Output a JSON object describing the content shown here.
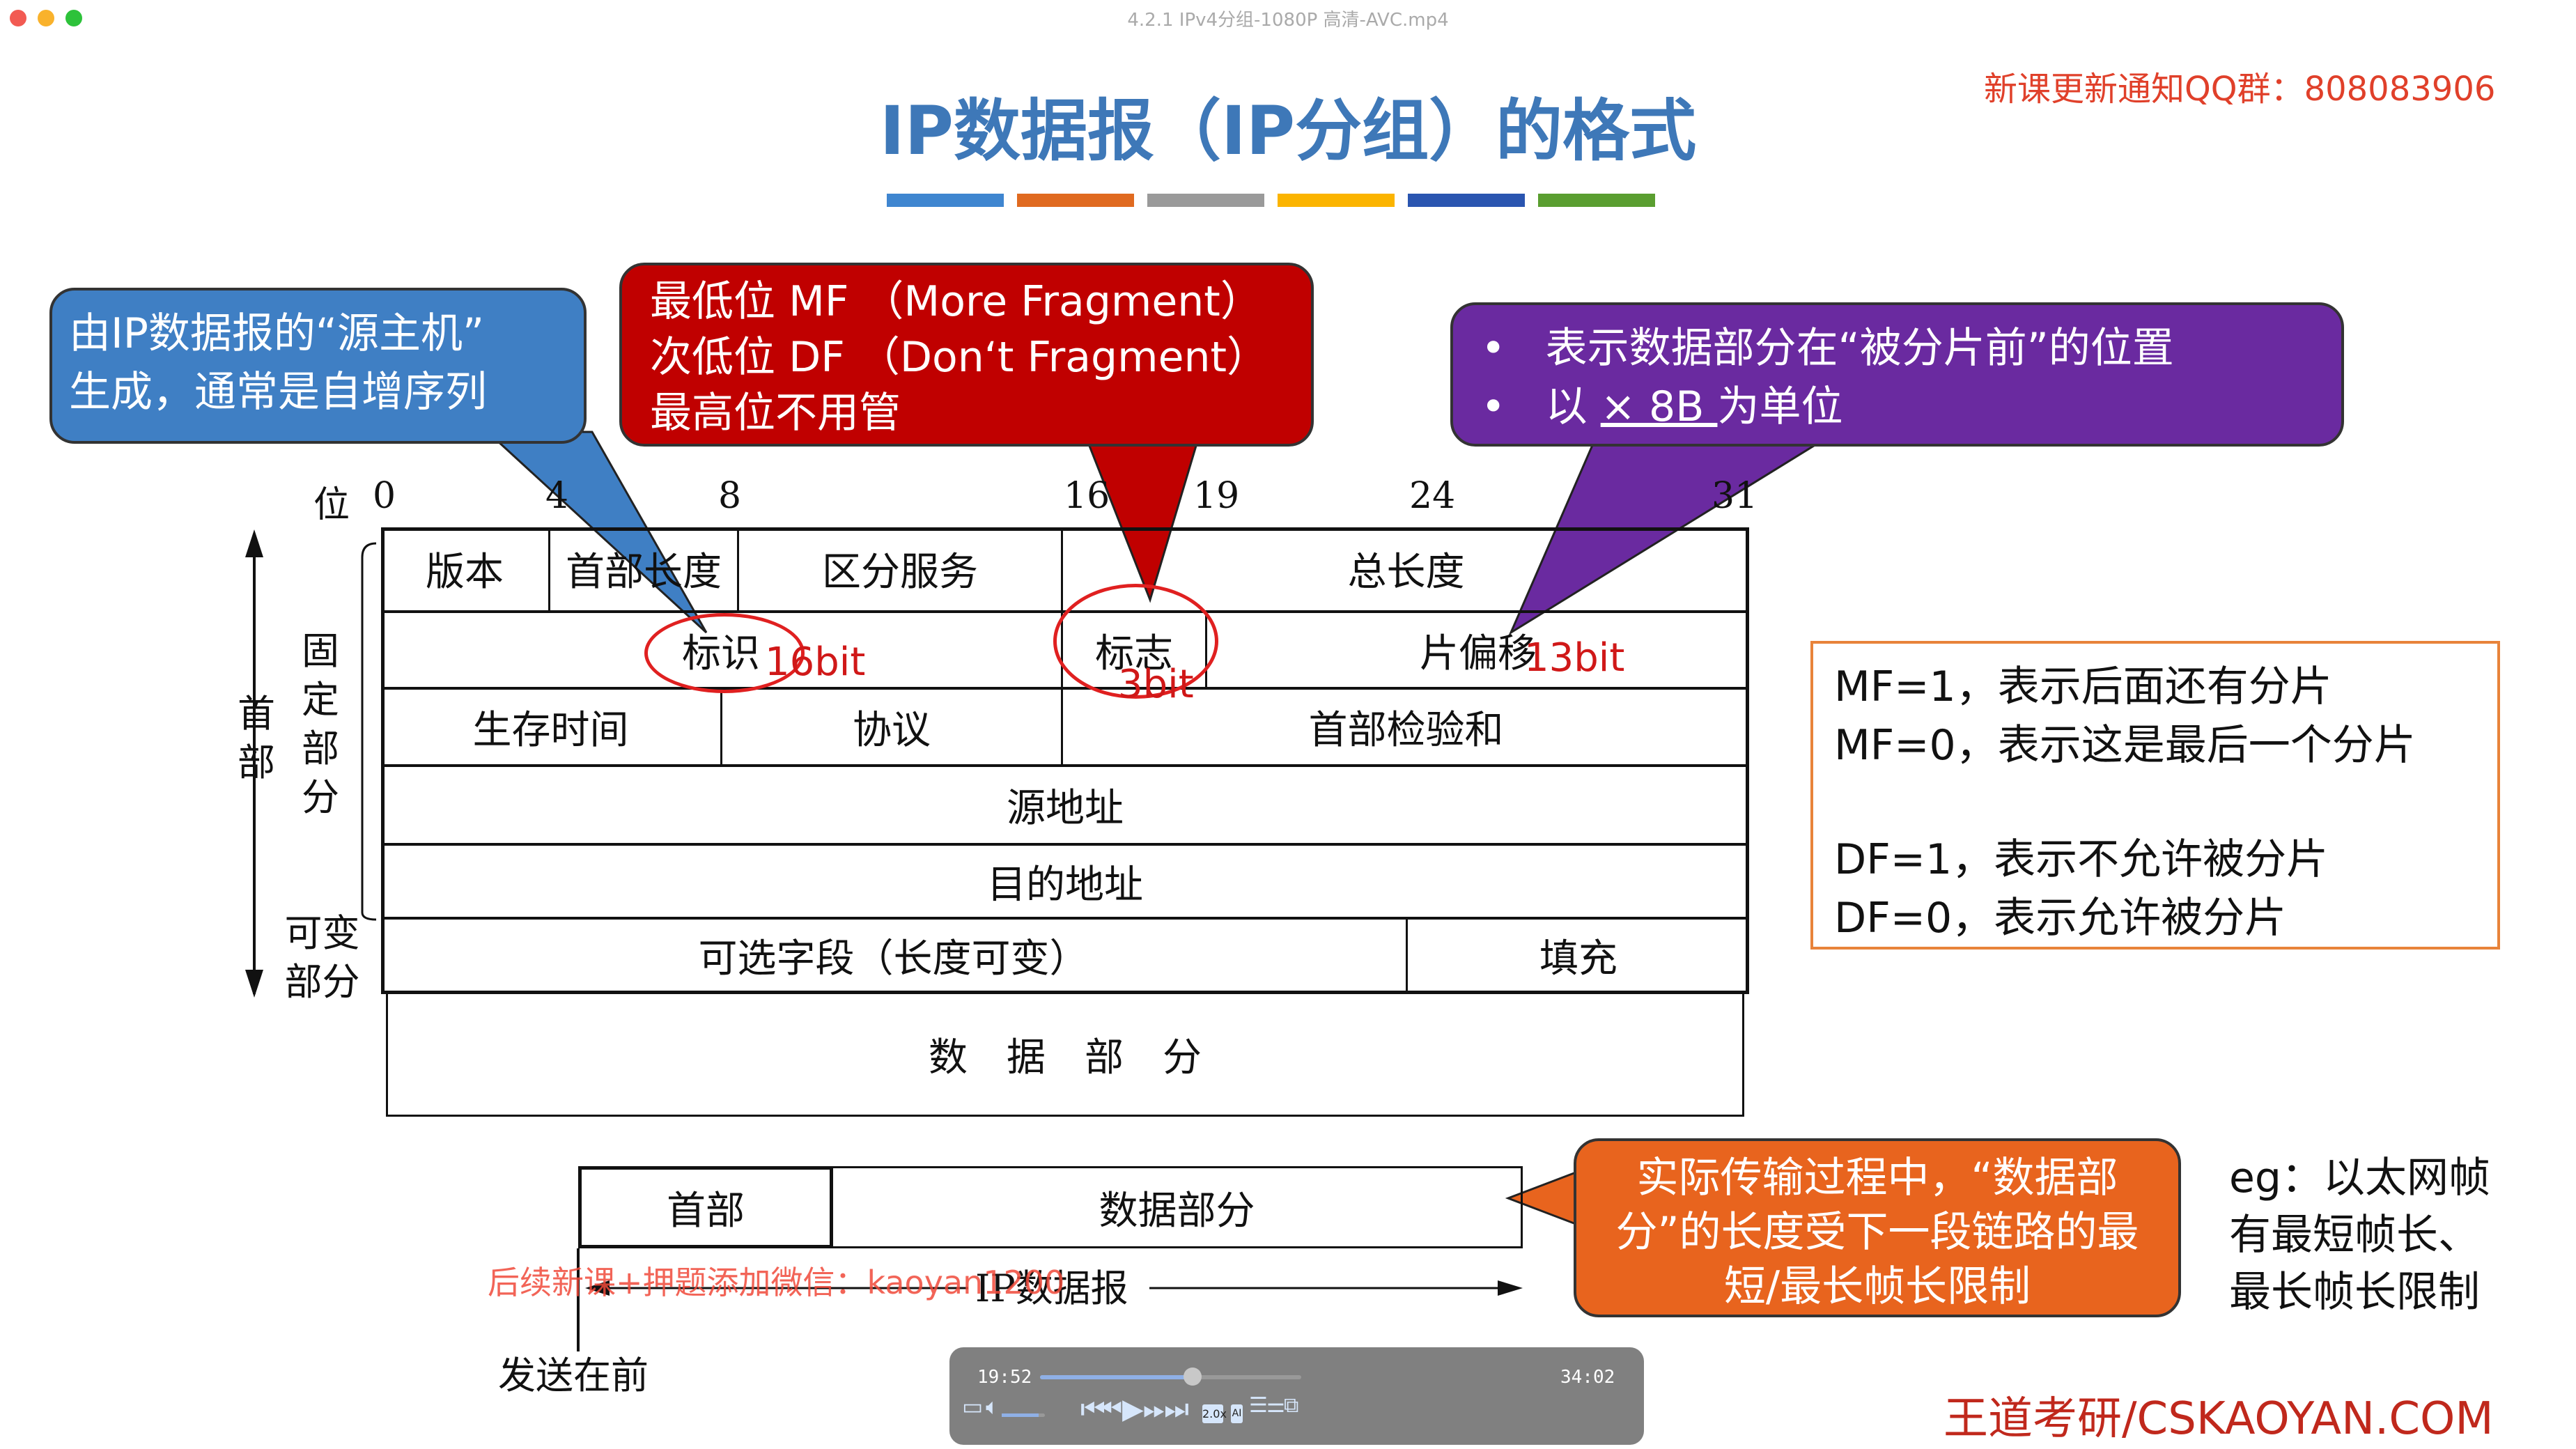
{
  "window": {
    "filename": "4.2.1 IPv4分组-1080P 高清-AVC.mp4"
  },
  "slide": {
    "title": "IP数据报（IP分组）的格式",
    "qq_notice": "新课更新通知QQ群：808083906",
    "title_bar_colors": [
      "#3f86d0",
      "#e06a20",
      "#9a9a9a",
      "#fbb400",
      "#2a55b0",
      "#5a9e30"
    ],
    "callout_blue": {
      "line1": "由IP数据报的“源主机”",
      "line2": "生成，通常是自增序列",
      "color": "#3f7fc4"
    },
    "callout_red": {
      "line1": "最低位 MF （More Fragment）",
      "line2": "次低位 DF （Don‘t Fragment）",
      "line3": "最高位不用管",
      "color": "#c00000"
    },
    "callout_purple": {
      "bullet1": "表示数据部分在“被分片前”的位置",
      "bullet2_prefix": "以 ",
      "bullet2_underlined": "× 8B ",
      "bullet2_suffix": "为单位",
      "color": "#6a2aa0"
    },
    "bits": {
      "label": "位",
      "values": [
        "0",
        "4",
        "8",
        "16",
        "19",
        "24",
        "31"
      ]
    },
    "table": {
      "row1": [
        "版本",
        "首部长度",
        "区分服务",
        "总长度"
      ],
      "row2": [
        "标识",
        "标志",
        "片偏移"
      ],
      "row3": [
        "生存时间",
        "协议",
        "首部检验和"
      ],
      "row4": "源地址",
      "row5": "目的地址",
      "row6": [
        "可选字段（长度可变）",
        "填充"
      ],
      "data": "数　据　部　分"
    },
    "annotations": {
      "id_bits": "16bit",
      "flag_bits": "3bit",
      "offset_bits": "13bit"
    },
    "side_labels": {
      "header": "首部",
      "fixed": "固定部分",
      "variable": "可变部分"
    },
    "right_box": [
      "MF=1，表示后面还有分片",
      "MF=0，表示这是最后一个分片",
      "DF=1，表示不允许被分片",
      "DF=0，表示允许被分片"
    ],
    "bottom": {
      "header": "首部",
      "data": "数据部分",
      "datagram": "IP数据报",
      "send_first": "发送在前",
      "watermark": "后续新课+押题添加微信：kaoyan1200"
    },
    "callout_orange": {
      "text": "实际传输过程中，“数据部分”的长度受下一段链路的最短/最长帧长限制",
      "color": "#e8641e"
    },
    "eg_note": [
      "eg：以太网帧",
      "有最短帧长、",
      "最长帧长限制"
    ],
    "brand": "王道考研/CSKAOYAN.COM"
  },
  "player": {
    "current_time": "19:52",
    "total_time": "34:02",
    "progress": 0.583,
    "volume": 0.85,
    "speed": "2.0x",
    "ai_label": "AI"
  }
}
